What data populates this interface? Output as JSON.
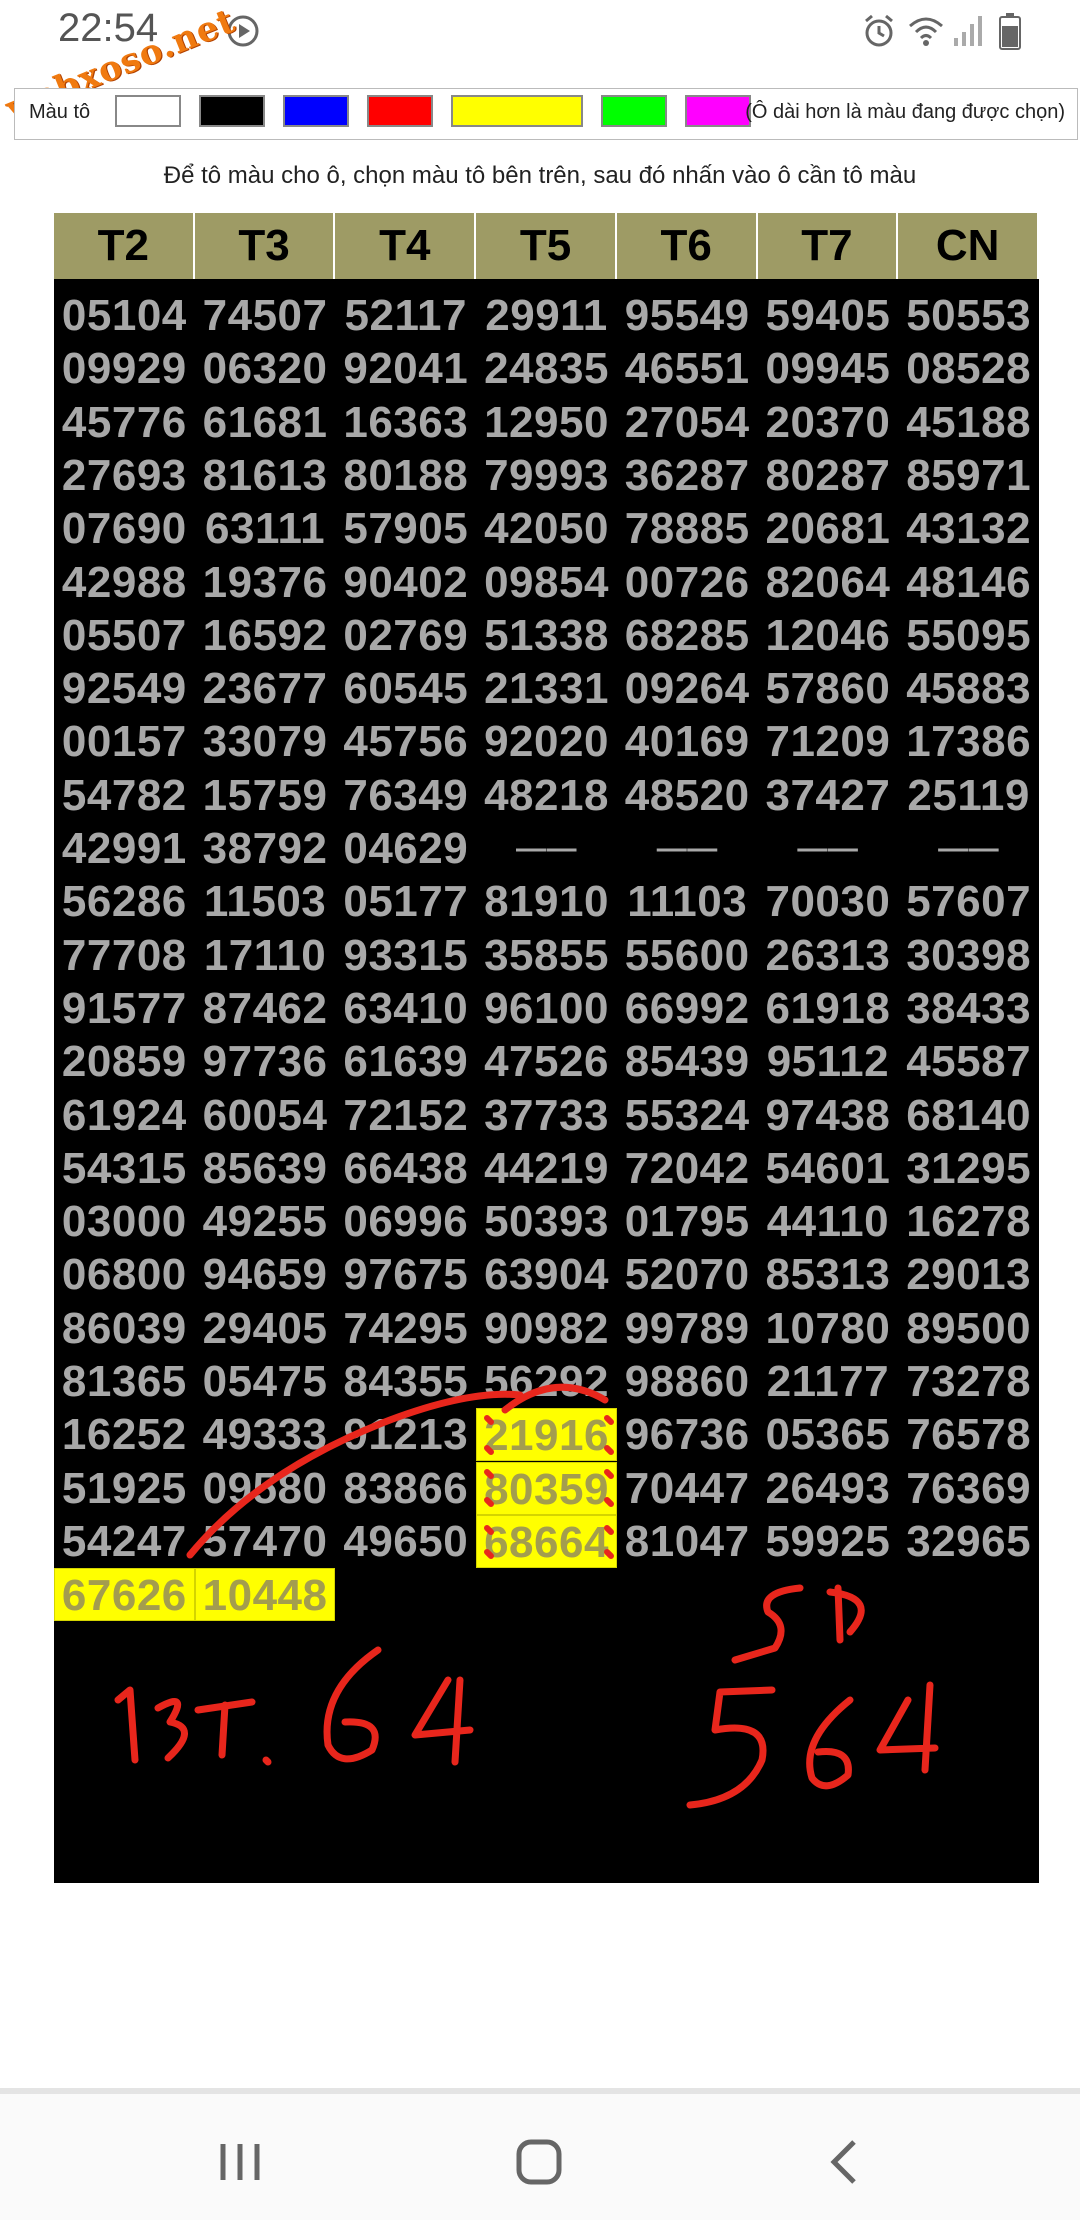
{
  "status": {
    "time": "22:54"
  },
  "watermark": {
    "text": "webxoso.net"
  },
  "color_picker": {
    "label": "Màu tô",
    "swatches": [
      {
        "name": "white",
        "color": "#ffffff"
      },
      {
        "name": "black",
        "color": "#000000"
      },
      {
        "name": "blue",
        "color": "#0000ff"
      },
      {
        "name": "red",
        "color": "#ff0000"
      },
      {
        "name": "yellow",
        "color": "#ffff00"
      },
      {
        "name": "green",
        "color": "#00ff00"
      },
      {
        "name": "magenta",
        "color": "#ff00ff"
      }
    ],
    "hint": "(Ô dài hơn là màu đang được chọn)"
  },
  "instruction": "Để tô màu cho ô, chọn màu tô bên trên, sau đó nhấn vào ô cần tô màu",
  "table": {
    "headers": [
      "T2",
      "T3",
      "T4",
      "T5",
      "T6",
      "T7",
      "CN"
    ],
    "rows": [
      [
        "05104",
        "74507",
        "52117",
        "29911",
        "95549",
        "59405",
        "50553"
      ],
      [
        "09929",
        "06320",
        "92041",
        "24835",
        "46551",
        "09945",
        "08528"
      ],
      [
        "45776",
        "61681",
        "16363",
        "12950",
        "27054",
        "20370",
        "45188"
      ],
      [
        "27693",
        "81613",
        "80188",
        "79993",
        "36287",
        "80287",
        "85971"
      ],
      [
        "07690",
        "63111",
        "57905",
        "42050",
        "78885",
        "20681",
        "43132"
      ],
      [
        "42988",
        "19376",
        "90402",
        "09854",
        "00726",
        "82064",
        "48146"
      ],
      [
        "05507",
        "16592",
        "02769",
        "51338",
        "68285",
        "12046",
        "55095"
      ],
      [
        "92549",
        "23677",
        "60545",
        "21331",
        "09264",
        "57860",
        "45883"
      ],
      [
        "00157",
        "33079",
        "45756",
        "92020",
        "40169",
        "71209",
        "17386"
      ],
      [
        "54782",
        "15759",
        "76349",
        "48218",
        "48520",
        "37427",
        "25119"
      ],
      [
        "42991",
        "38792",
        "04629",
        "——",
        "——",
        "——",
        "——"
      ],
      [
        "56286",
        "11503",
        "05177",
        "81910",
        "11103",
        "70030",
        "57607"
      ],
      [
        "77708",
        "17110",
        "93315",
        "35855",
        "55600",
        "26313",
        "30398"
      ],
      [
        "91577",
        "87462",
        "63410",
        "96100",
        "66992",
        "61918",
        "38433"
      ],
      [
        "20859",
        "97736",
        "61639",
        "47526",
        "85439",
        "95112",
        "45587"
      ],
      [
        "61924",
        "60054",
        "72152",
        "37733",
        "55324",
        "97438",
        "68140"
      ],
      [
        "54315",
        "85639",
        "66438",
        "44219",
        "72042",
        "54601",
        "31295"
      ],
      [
        "03000",
        "49255",
        "06996",
        "50393",
        "01795",
        "44110",
        "16278"
      ],
      [
        "06800",
        "94659",
        "97675",
        "63904",
        "52070",
        "85313",
        "29013"
      ],
      [
        "86039",
        "29405",
        "74295",
        "90982",
        "99789",
        "10780",
        "89500"
      ],
      [
        "81365",
        "05475",
        "84355",
        "56292",
        "98860",
        "21177",
        "73278"
      ],
      [
        "16252",
        "49333",
        "91213",
        "21916",
        "96736",
        "05365",
        "76578"
      ],
      [
        "51925",
        "09580",
        "83866",
        "80359",
        "70447",
        "26493",
        "76369"
      ],
      [
        "54247",
        "57470",
        "49650",
        "68664",
        "81047",
        "59925",
        "32965"
      ],
      [
        "67626",
        "10448",
        "",
        "",
        "",
        "",
        ""
      ]
    ],
    "highlighted": [
      {
        "row": 21,
        "col": 3
      },
      {
        "row": 22,
        "col": 3
      },
      {
        "row": 23,
        "col": 3
      },
      {
        "row": 24,
        "col": 0
      },
      {
        "row": 24,
        "col": 1
      }
    ],
    "highlight_color": "#ffff00"
  },
  "annotations": {
    "note_left": "13T. 64",
    "note_right_top": "SD",
    "note_right_bottom": "564",
    "ink_color": "#e8261c"
  },
  "nav": {
    "buttons": [
      "recent-apps",
      "home",
      "back"
    ]
  }
}
